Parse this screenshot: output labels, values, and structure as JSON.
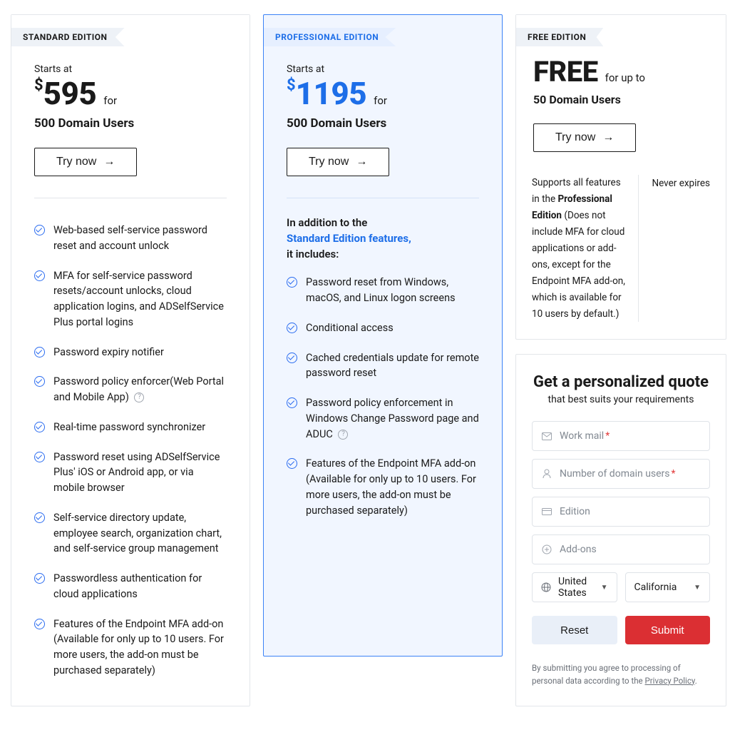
{
  "plans": {
    "standard": {
      "badge": "STANDARD EDITION",
      "starts": "Starts at",
      "currency": "$",
      "price": "595",
      "for": "for",
      "users": "500 Domain Users",
      "cta": "Try now",
      "features": [
        "Web-based self-service password reset and account unlock",
        "MFA for self-service password resets/account unlocks, cloud application logins, and ADSelfService Plus portal logins",
        "Password expiry notifier",
        "Password policy enforcer(Web Portal and Mobile App)",
        "Real-time password synchronizer",
        "Password reset using ADSelfService Plus' iOS or Android app, or via mobile browser",
        "Self-service directory update, employee search, organization chart, and self-service group management",
        "Passwordless authentication for cloud applications",
        "Features of the Endpoint MFA add-on (Available for only up to 10 users. For more users, the add-on must be purchased separately)"
      ],
      "help_on": [
        3
      ]
    },
    "professional": {
      "badge": "PROFESSIONAL EDITION",
      "starts": "Starts at",
      "currency": "$",
      "price": "1195",
      "for": "for",
      "users": "500 Domain Users",
      "cta": "Try now",
      "intro_1": "In addition to the",
      "intro_bold": "Standard Edition features,",
      "intro_2": "it includes:",
      "features": [
        "Password reset from Windows, macOS, and Linux logon screens",
        "Conditional access",
        "Cached credentials update for remote password reset",
        "Password policy enforcement in Windows Change Password page and ADUC",
        "Features of the Endpoint MFA add-on (Available for only up to 10 users. For more users, the add-on must be purchased separately)"
      ],
      "help_on": [
        3
      ]
    },
    "free": {
      "badge": "FREE EDITION",
      "price_text": "FREE",
      "for_text": "for up to",
      "users": "50 Domain Users",
      "cta": "Try now",
      "note_1": "Supports all features in the ",
      "note_bold": "Professional Edition",
      "note_2": " (Does not include MFA for cloud applications or add-ons, except for the Endpoint MFA add-on, which is available for 10 users by default.)",
      "never": "Never expires"
    }
  },
  "quote": {
    "title": "Get a personalized quote",
    "sub": "that best suits your requirements",
    "work_mail": "Work mail",
    "users": "Number of domain users",
    "edition": "Edition",
    "addons": "Add-ons",
    "country": "United States",
    "state": "California",
    "reset": "Reset",
    "submit": "Submit",
    "legal_1": "By submitting you agree to processing of personal data according to the ",
    "legal_link": "Privacy Policy",
    "legal_2": "."
  }
}
